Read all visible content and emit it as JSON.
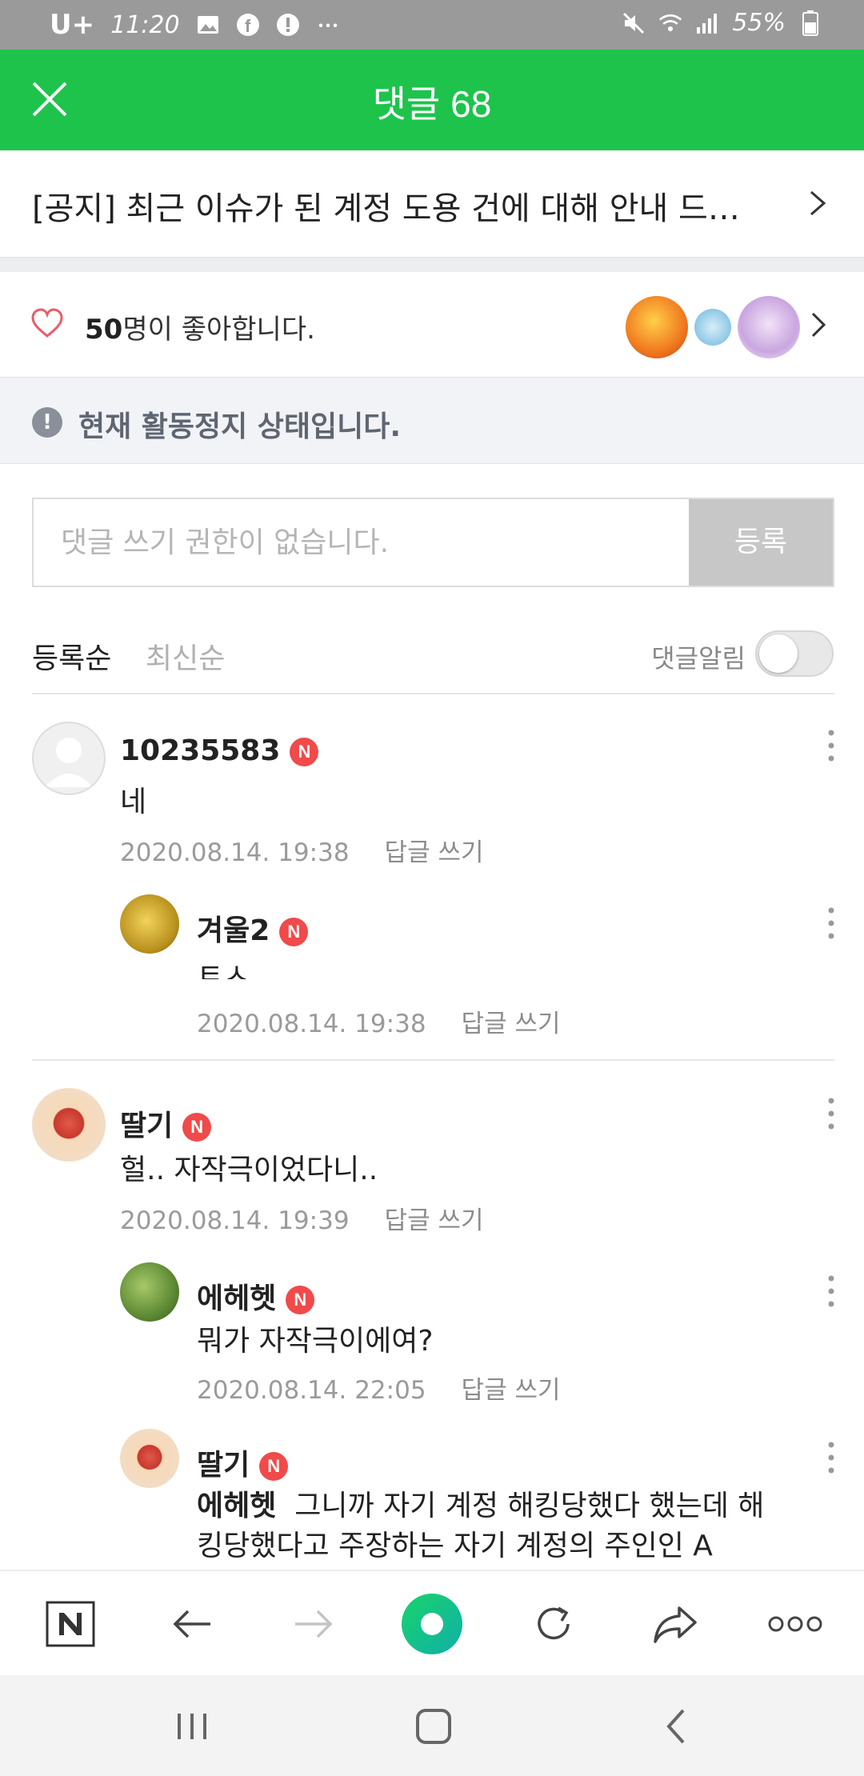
{
  "status_bar": {
    "carrier": "U+",
    "time": "11:20",
    "battery": "55%",
    "icons": [
      "image-icon",
      "facebook-icon",
      "alert-icon",
      "more-dots-icon",
      "mute-icon",
      "wifi-icon",
      "signal-icon",
      "battery-icon"
    ]
  },
  "header": {
    "title": "댓글 68"
  },
  "notice": {
    "text": "[공지] 최근 이슈가 된 계정 도용 건에 대해 안내 드…"
  },
  "likes": {
    "count": "50",
    "suffix": "명이 좋아합니다."
  },
  "banner": {
    "text": "현재 활동정지 상태입니다."
  },
  "comment_input": {
    "placeholder": "댓글 쓰기 권한이 없습니다.",
    "submit_label": "등록"
  },
  "sort": {
    "tab_registered": "등록순",
    "tab_latest": "최신순",
    "alarm_label": "댓글알림",
    "alarm_on": false
  },
  "comments": [
    {
      "name": "10235583",
      "badge": "N",
      "body": "네",
      "date": "2020.08.14. 19:38",
      "reply_label": "답글 쓰기"
    },
    {
      "name": "겨울2",
      "badge": "N",
      "body": "ㅌㅅ",
      "date": "2020.08.14. 19:38",
      "reply_label": "답글 쓰기"
    },
    {
      "name": "딸기",
      "badge": "N",
      "body": "헐.. 자작극이었다니..",
      "date": "2020.08.14. 19:39",
      "reply_label": "답글 쓰기"
    },
    {
      "name": "에헤헷",
      "badge": "N",
      "body": "뭐가 자작극이에여?",
      "date": "2020.08.14. 22:05",
      "reply_label": "답글 쓰기"
    },
    {
      "name": "딸기",
      "badge": "N",
      "mention": "에헤헷",
      "body": "그니까 자기 계정 해킹당했다 했는데 해킹당했다고 주장하는 자기 계정의 주인인 A"
    }
  ],
  "colors": {
    "brand_green": "#1ec34c",
    "badge_red": "#f04a4a"
  }
}
